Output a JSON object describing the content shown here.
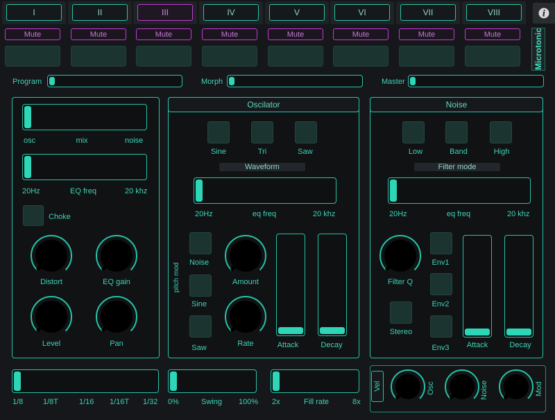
{
  "channels": {
    "tabs": [
      "I",
      "II",
      "III",
      "IV",
      "V",
      "VI",
      "VII",
      "VIII"
    ],
    "selected_index": 2,
    "mute_label": "Mute"
  },
  "brand": "Microtonic",
  "info_icon": "info-icon",
  "top_sliders": {
    "program": {
      "label": "Program",
      "value": 0.0
    },
    "morph": {
      "label": "Morph",
      "value": 0.0
    },
    "master": {
      "label": "Master",
      "value": 0.0
    }
  },
  "left_panel": {
    "mix": {
      "left": "osc",
      "center": "mix",
      "right": "noise",
      "value": 0.0
    },
    "eq_freq": {
      "left": "20Hz",
      "center": "EQ freq",
      "right": "20 khz",
      "value": 0.0
    },
    "choke_label": "Choke",
    "knobs": {
      "distort": "Distort",
      "eq_gain": "EQ gain",
      "level": "Level",
      "pan": "Pan"
    }
  },
  "oscillator": {
    "title": "Oscilator",
    "waveforms": [
      "Sine",
      "Tri",
      "Saw"
    ],
    "waveform_label": "Waveform",
    "eq_freq": {
      "left": "20Hz",
      "center": "eq freq",
      "right": "20 khz",
      "value": 0.0
    },
    "pitch_mod_label": "pitch mod",
    "pitch_mod_options": [
      "Noise",
      "Sine",
      "Saw"
    ],
    "amount_label": "Amount",
    "rate_label": "Rate",
    "attack_label": "Attack",
    "decay_label": "Decay",
    "attack_value": 0.0,
    "decay_value": 0.0
  },
  "noise": {
    "title": "Noise",
    "filter_modes": [
      "Low",
      "Band",
      "High"
    ],
    "filter_mode_label": "Filter mode",
    "eq_freq": {
      "left": "20Hz",
      "center": "eq freq",
      "right": "20 khz",
      "value": 0.0
    },
    "filter_q_label": "Filter Q",
    "stereo_label": "Stereo",
    "envs": [
      "Env1",
      "Env2",
      "Env3"
    ],
    "attack_label": "Attack",
    "decay_label": "Decay",
    "attack_value": 0.0,
    "decay_value": 0.0
  },
  "bottom": {
    "rate": {
      "labels": [
        "1/8",
        "1/8T",
        "1/16",
        "1/16T",
        "1/32"
      ],
      "value": 0.0
    },
    "swing": {
      "left": "0%",
      "center": "Swing",
      "right": "100%",
      "value": 0.0
    },
    "fill_rate": {
      "left": "2x",
      "center": "Fill rate",
      "right": "8x",
      "value": 0.0
    },
    "vel_label": "Vel",
    "vel_knobs": [
      "Osc",
      "Noise",
      "Mod"
    ]
  }
}
